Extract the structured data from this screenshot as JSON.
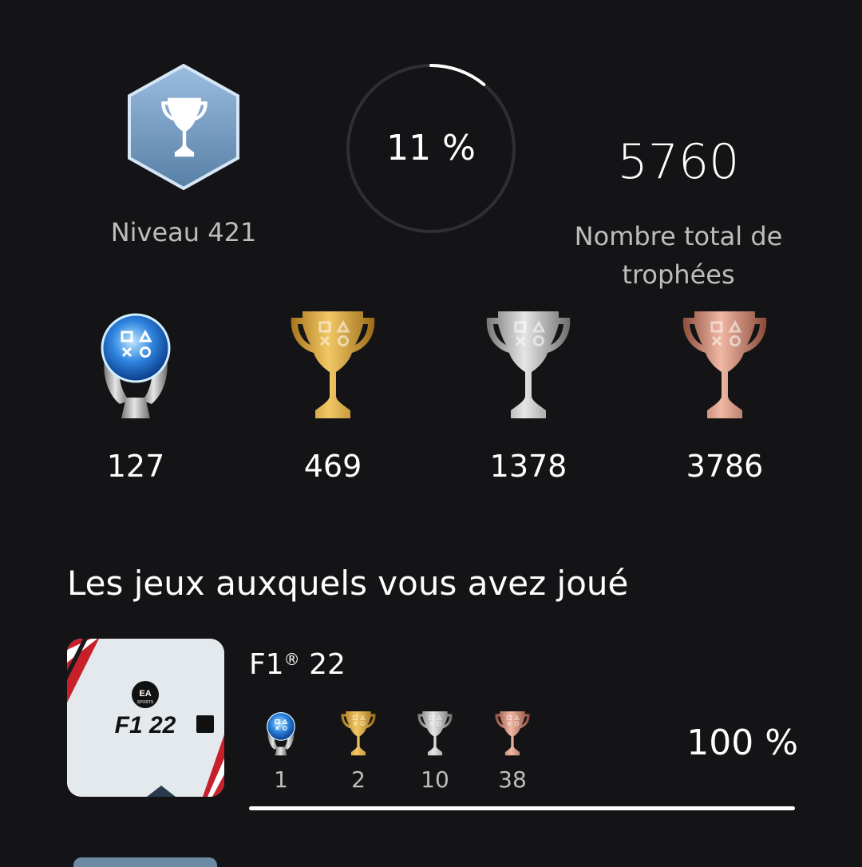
{
  "profile": {
    "level_label": "Niveau 421",
    "completion_text": "11 %",
    "completion_percent": 11,
    "total_trophies": "5760",
    "total_label_line1": "Nombre total de",
    "total_label_line2": "trophées"
  },
  "trophy_counts": {
    "platinum": "127",
    "gold": "469",
    "silver": "1378",
    "bronze": "3786"
  },
  "section_title": "Les jeux auxquels vous avez joué",
  "games": [
    {
      "title": "F1",
      "title_mark": "®",
      "title_suffix": " 22",
      "cover_badge": "EA",
      "cover_badge_sub": "SPORTS",
      "cover_logo": "F1 22",
      "trophies": {
        "platinum": "1",
        "gold": "2",
        "silver": "10",
        "bronze": "38"
      },
      "progress_text": "100 %",
      "progress_percent": 100
    }
  ],
  "icons": {
    "level": "level-trophy-hexagon-icon",
    "platinum": "platinum-trophy-icon",
    "gold": "gold-trophy-icon",
    "silver": "silver-trophy-icon",
    "bronze": "bronze-trophy-icon"
  },
  "colors": {
    "background": "#141416",
    "gold": "#d9a437",
    "silver": "#b8b8b8",
    "bronze": "#c9806b",
    "platinum": "#4aa8f0",
    "level_badge": "#7fa3c8"
  }
}
